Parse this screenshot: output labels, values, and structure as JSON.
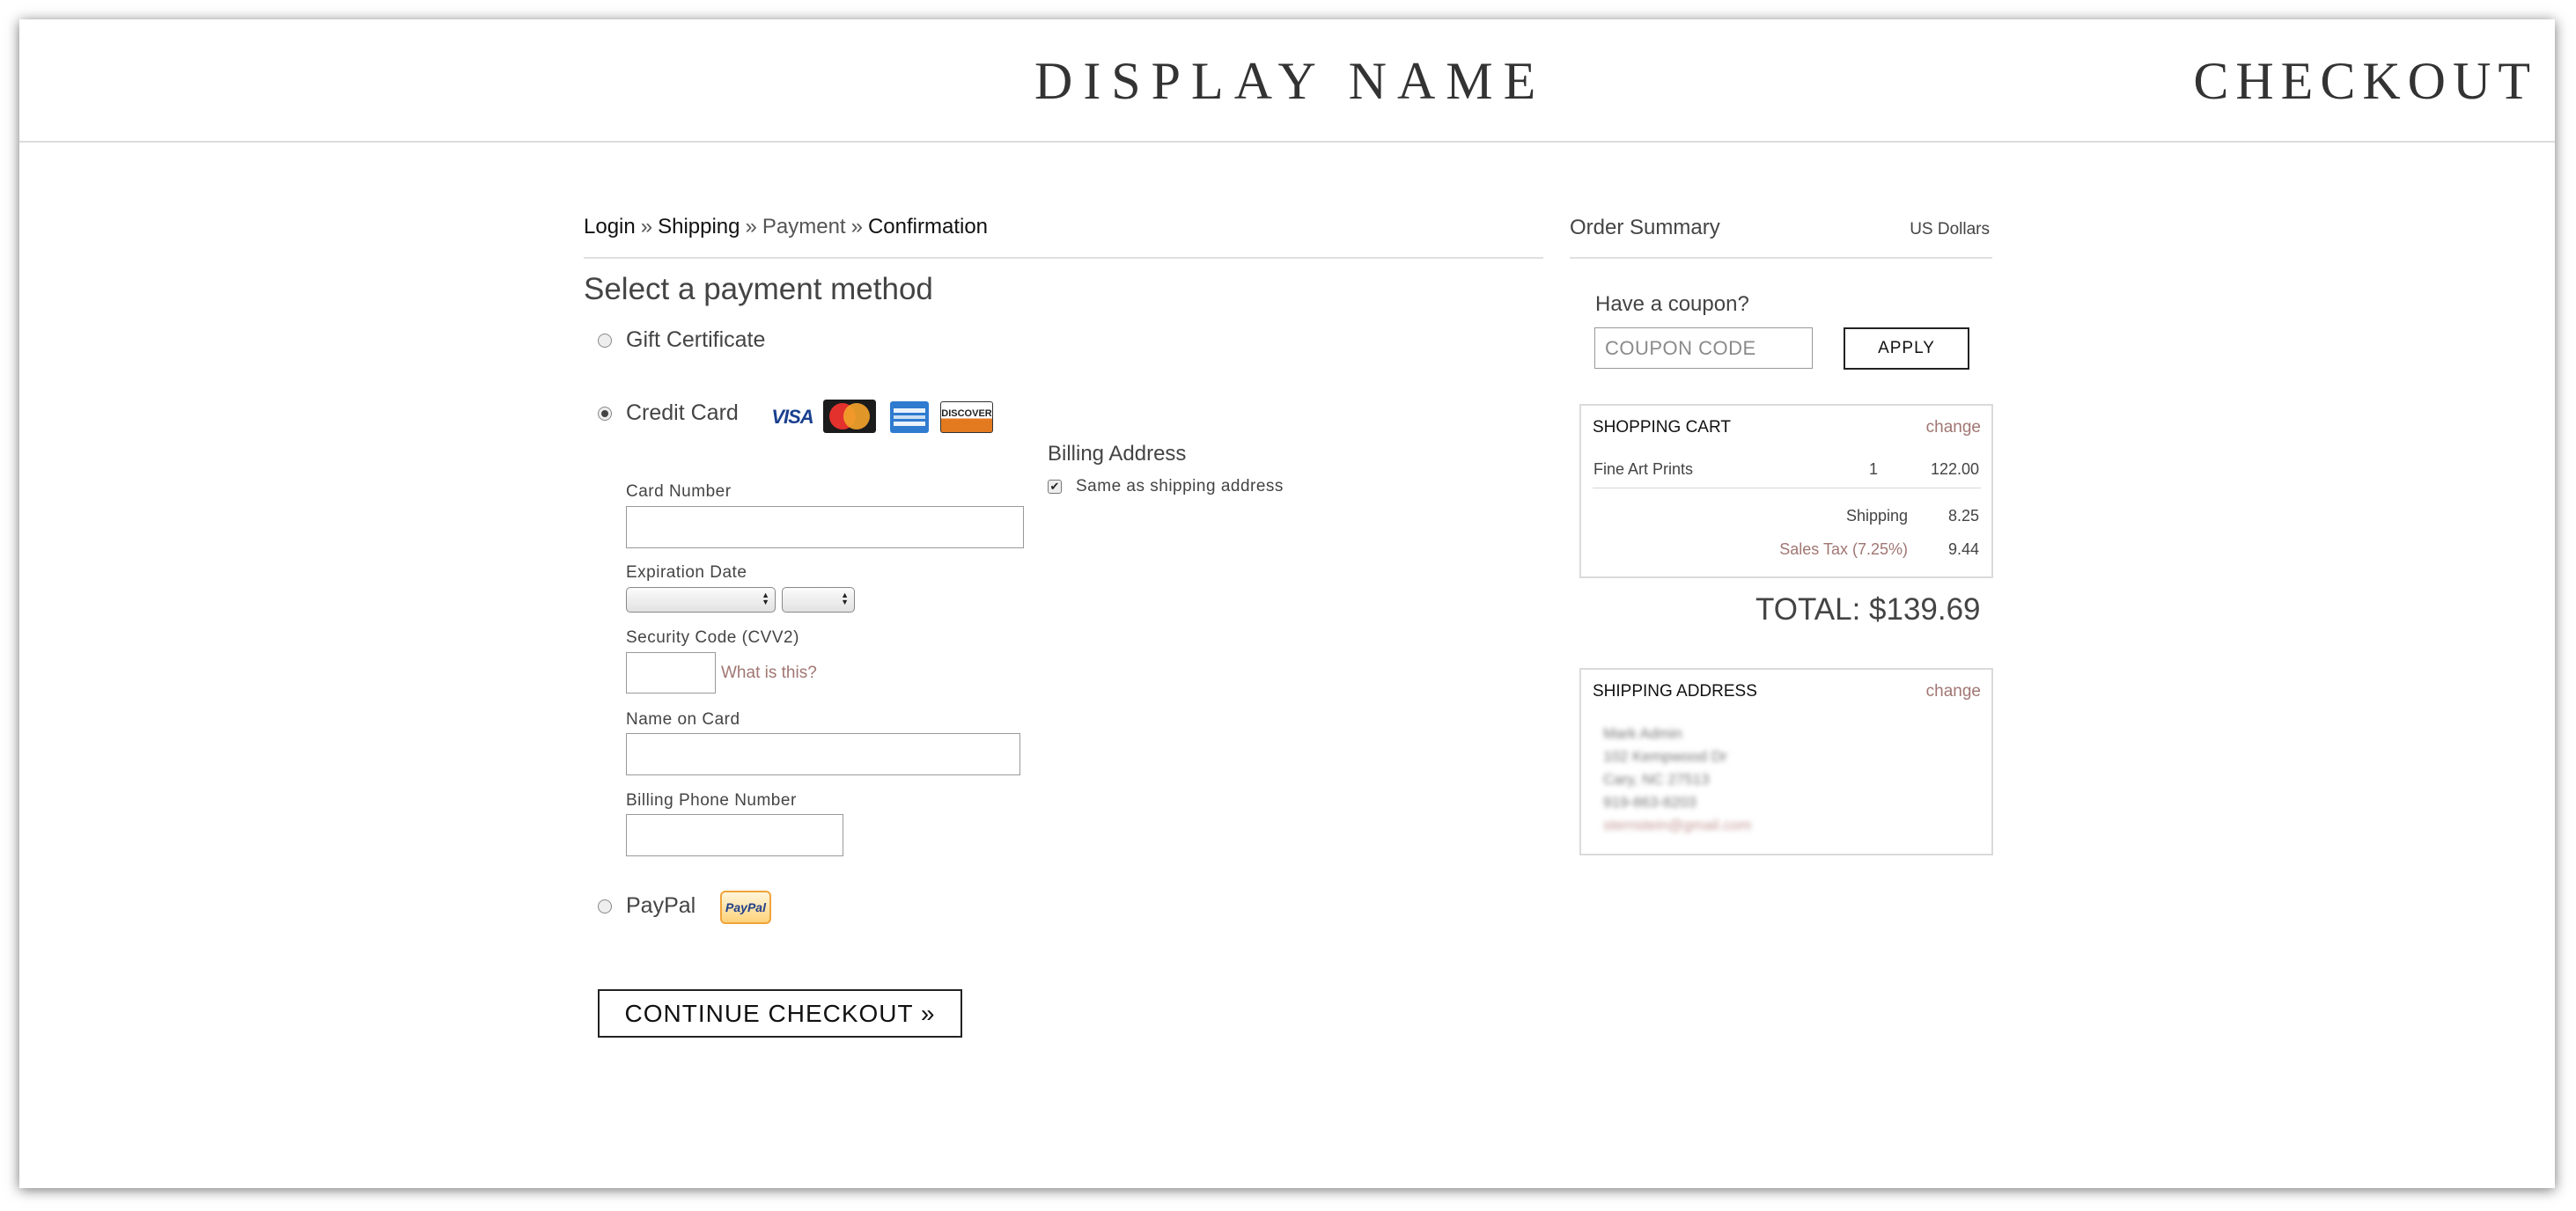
{
  "header": {
    "site_title": "DISPLAY NAME",
    "page_heading": "CHECKOUT"
  },
  "breadcrumb": {
    "steps": [
      "Login",
      "Shipping",
      "Payment",
      "Confirmation"
    ],
    "separator": "»"
  },
  "payment": {
    "title": "Select a payment method",
    "options": {
      "gift_certificate": {
        "label": "Gift Certificate",
        "selected": false
      },
      "credit_card": {
        "label": "Credit Card",
        "selected": true,
        "card_brands": [
          "VISA",
          "MasterCard",
          "American Express",
          "DISCOVER"
        ]
      },
      "paypal": {
        "label": "PayPal",
        "selected": false,
        "logo_text": "PayPal"
      }
    },
    "card_form": {
      "card_number_label": "Card Number",
      "expiration_label": "Expiration Date",
      "security_code_label": "Security Code (CVV2)",
      "what_is_this": "What is this?",
      "name_label": "Name on Card",
      "phone_label": "Billing Phone Number"
    },
    "billing": {
      "title": "Billing Address",
      "same_as_shipping_label": "Same as shipping address",
      "same_as_shipping_checked": true
    },
    "continue_label": "CONTINUE CHECKOUT »"
  },
  "summary": {
    "title": "Order Summary",
    "currency": "US Dollars",
    "coupon": {
      "label": "Have a coupon?",
      "placeholder": "COUPON CODE",
      "apply_label": "APPLY"
    },
    "cart": {
      "title": "SHOPPING CART",
      "change_label": "change",
      "items": [
        {
          "name": "Fine Art Prints",
          "qty": "1",
          "price": "122.00"
        }
      ],
      "shipping_label": "Shipping",
      "shipping_value": "8.25",
      "tax_label": "Sales Tax (7.25%)",
      "tax_value": "9.44"
    },
    "total": "TOTAL: $139.69",
    "shipping_address": {
      "title": "SHIPPING ADDRESS",
      "change_label": "change",
      "lines": [
        "Mark Admin",
        "102 Kempwood Dr",
        "Cary, NC 27513",
        "919-863-8203",
        "sternstein@gmail.com"
      ]
    }
  },
  "colors": {
    "accent_link": "#a07672",
    "text": "#444444",
    "border": "#dadada"
  }
}
